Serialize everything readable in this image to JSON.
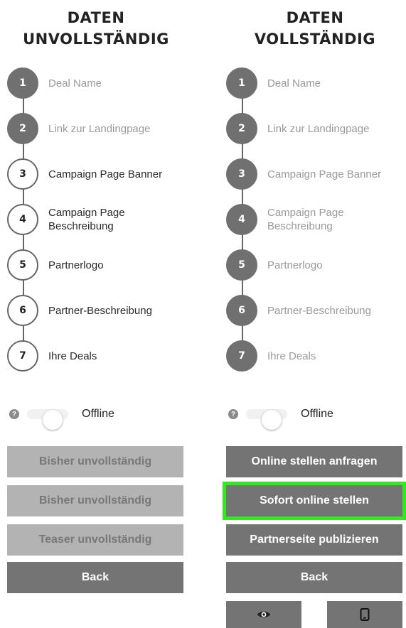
{
  "columns": [
    {
      "title_line1": "DATEN",
      "title_line2": "UNVOLLSTÄNDIG",
      "steps": [
        {
          "number": "1",
          "label": "Deal Name",
          "state": "done"
        },
        {
          "number": "2",
          "label": "Link zur Landingpage",
          "state": "done"
        },
        {
          "number": "3",
          "label": "Campaign Page Banner",
          "state": "todo"
        },
        {
          "number": "4",
          "label": "Campaign Page Beschreibung",
          "state": "todo"
        },
        {
          "number": "5",
          "label": "Partnerlogo",
          "state": "todo"
        },
        {
          "number": "6",
          "label": "Partner-Beschreibung",
          "state": "todo"
        },
        {
          "number": "7",
          "label": "Ihre Deals",
          "state": "todo"
        }
      ],
      "toggle_label": "Offline",
      "buttons": [
        {
          "label": "Bisher unvollständig",
          "style": "disabled"
        },
        {
          "label": "Bisher unvollständig",
          "style": "disabled"
        },
        {
          "label": "Teaser unvollständig",
          "style": "disabled"
        },
        {
          "label": "Back",
          "style": "dark"
        }
      ]
    },
    {
      "title_line1": "DATEN",
      "title_line2": "VOLLSTÄNDIG",
      "steps": [
        {
          "number": "1",
          "label": "Deal Name",
          "state": "done"
        },
        {
          "number": "2",
          "label": "Link zur Landingpage",
          "state": "done"
        },
        {
          "number": "3",
          "label": "Campaign Page Banner",
          "state": "done"
        },
        {
          "number": "4",
          "label": "Campaign Page Beschreibung",
          "state": "done"
        },
        {
          "number": "5",
          "label": "Partnerlogo",
          "state": "done"
        },
        {
          "number": "6",
          "label": "Partner-Beschreibung",
          "state": "done"
        },
        {
          "number": "7",
          "label": "Ihre Deals",
          "state": "done"
        }
      ],
      "toggle_label": "Offline",
      "buttons": [
        {
          "label": "Online stellen anfragen",
          "style": "dark"
        },
        {
          "label": "Sofort online stellen",
          "style": "dark",
          "highlighted": true
        },
        {
          "label": "Partnerseite publizieren",
          "style": "dark"
        },
        {
          "label": "Back",
          "style": "dark"
        }
      ],
      "icon_buttons": [
        "eye-icon",
        "mobile-phone-icon"
      ]
    }
  ],
  "colors": {
    "completed_step": "#707070",
    "disabled_button": "#b3b3b3",
    "dark_button": "#747474",
    "highlight_outline": "#33e81e"
  }
}
